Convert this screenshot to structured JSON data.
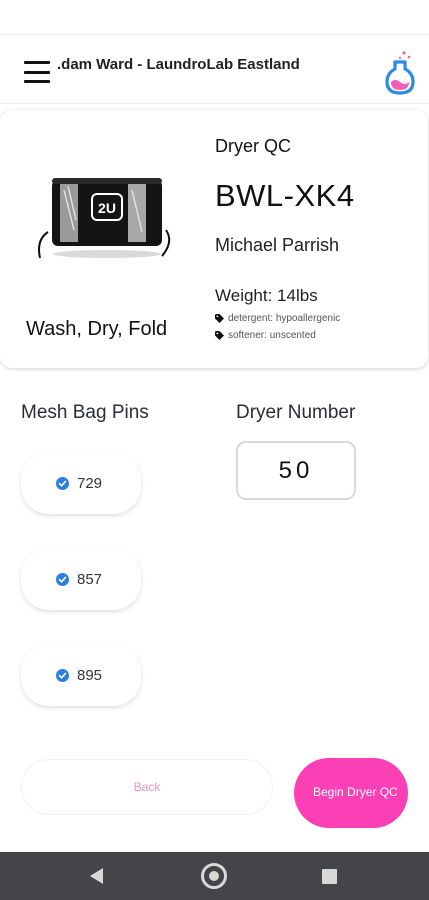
{
  "header": {
    "title": ".dam Ward - LaundroLab Eastland",
    "menu_icon": "hamburger-menu-icon",
    "logo_icon": "laundrolab-flask-logo"
  },
  "order": {
    "qc_label": "Dryer QC",
    "bag_code": "BWL-XK4",
    "customer_name": "Michael Parrish",
    "weight": "Weight: 14lbs",
    "service": "Wash, Dry, Fold",
    "bag_logo_text": "2U",
    "tags": [
      {
        "text": "detergent: hypoallergenic",
        "icon": "tag-icon"
      },
      {
        "text": "softener: unscented",
        "icon": "tag-icon"
      }
    ]
  },
  "mesh_bag_pins": {
    "label": "Mesh Bag Pins",
    "pins": [
      {
        "value": "729",
        "checked": true
      },
      {
        "value": "857",
        "checked": true
      },
      {
        "value": "895",
        "checked": true
      }
    ]
  },
  "dryer": {
    "label": "Dryer Number",
    "value": "50"
  },
  "actions": {
    "back_label": "Back",
    "begin_label": "Begin Dryer QC"
  },
  "colors": {
    "accent_pink": "#fb3fb4",
    "back_text_pink": "#f08fc7",
    "check_blue": "#2f7fe0",
    "logo_blue": "#2a8be0",
    "nav_bar": "#434549"
  },
  "system_nav": {
    "icons": [
      "back-triangle-icon",
      "home-circle-icon",
      "recent-apps-square-icon"
    ]
  }
}
